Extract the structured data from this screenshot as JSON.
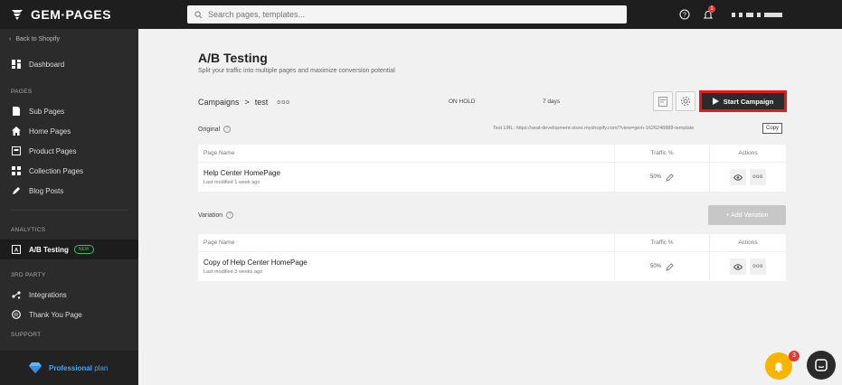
{
  "topbar": {
    "brand": "GEM·PAGES",
    "search_placeholder": "Search pages, templates...",
    "notification_count": "1"
  },
  "sidebar": {
    "back_label": "Back to Shopify",
    "dashboard": "Dashboard",
    "sections": {
      "pages": "PAGES",
      "analytics": "ANALYTICS",
      "third_party": "3RD PARTY",
      "support": "SUPPORT"
    },
    "pages_items": [
      "Sub Pages",
      "Home Pages",
      "Product Pages",
      "Collection Pages",
      "Blog Posts"
    ],
    "ab_testing": "A/B Testing",
    "new_badge": "NEW",
    "third_party_items": [
      "Integrations",
      "Thank You Page"
    ],
    "plan_label": "Professional",
    "plan_suffix": "plan"
  },
  "main": {
    "title": "A/B Testing",
    "subtitle": "Split your traffic into multiple pages and maximize conversion potential",
    "breadcrumb_root": "Campaigns",
    "breadcrumb_sep": ">",
    "breadcrumb_current": "test",
    "breadcrumb_more": "ooo",
    "status": "ON HOLD",
    "duration": "7 days",
    "start_button": "Start Campaign",
    "original_label": "Original",
    "test_url": "Test URL: https://seal-development-store.myshopify.com/?view=gem-1626248888-template",
    "copy_label": "Copy",
    "variation_label": "Variation",
    "add_variation": "+ Add Variation",
    "columns": {
      "page_name": "Page Name",
      "traffic": "Traffic %",
      "actions": "Actions"
    },
    "original_row": {
      "name": "Help Center HomePage",
      "modified": "Last modified 1 week ago",
      "traffic": "50%"
    },
    "variation_row": {
      "name": "Copy of Help Center HomePage",
      "modified": "Last modified 3 weeks ago",
      "traffic": "50%"
    },
    "more_label": "ooo"
  },
  "widgets": {
    "bell_count": "3"
  },
  "colors": {
    "accent_red": "#e21b1b",
    "new_green": "#3fbf6a",
    "plan_blue": "#3da9ff",
    "bell": "#f7b500"
  }
}
